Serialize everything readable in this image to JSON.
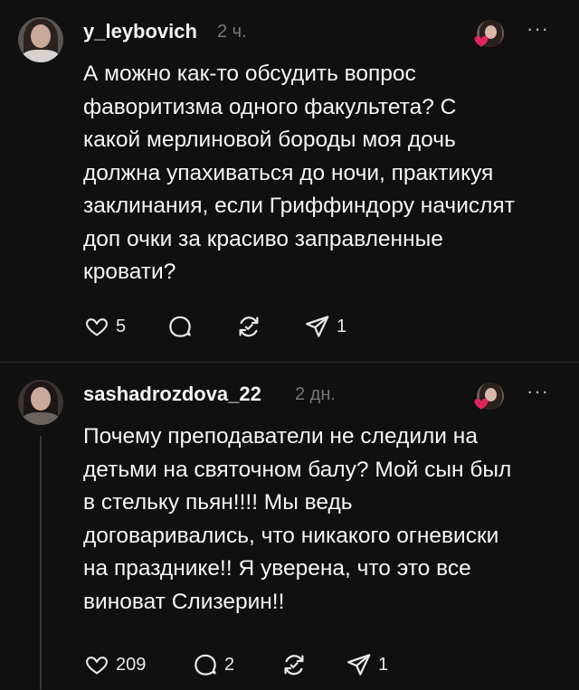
{
  "posts": [
    {
      "username": "y_leybovich",
      "time": "2 ч.",
      "text": "А можно как-то обсудить вопрос\nфаворитизма одного факультета? С\nкакой мерлиновой бороды моя дочь\nдолжна упахиваться до ночи, практикуя\nзаклинания, если Гриффиндору начислят\nдоп очки за красиво заправленные\nкровати?",
      "more": "···",
      "likes": "5",
      "replies": "",
      "reposts": "",
      "shares": "1"
    },
    {
      "username": "sashadrozdova_22",
      "time": "2 дн.",
      "text": "Почему преподаватели не следили на\nдетьми на святочном балу? Мой сын был\nв стельку пьян!!!! Мы ведь\nдоговаривались, что никакого огневиски\nна празднике!! Я уверена, что это все\nвиноват Слизерин!!",
      "more": "···",
      "likes": "209",
      "replies": "2",
      "reposts": "",
      "shares": "1"
    }
  ],
  "colors": {
    "background": "#101010",
    "text": "#f3f5f7",
    "muted": "#777777",
    "heart": "#e0245e"
  },
  "icons": [
    "heart-outline-icon",
    "comment-icon",
    "repost-icon",
    "share-icon",
    "more-icon",
    "liked-heart-icon"
  ]
}
